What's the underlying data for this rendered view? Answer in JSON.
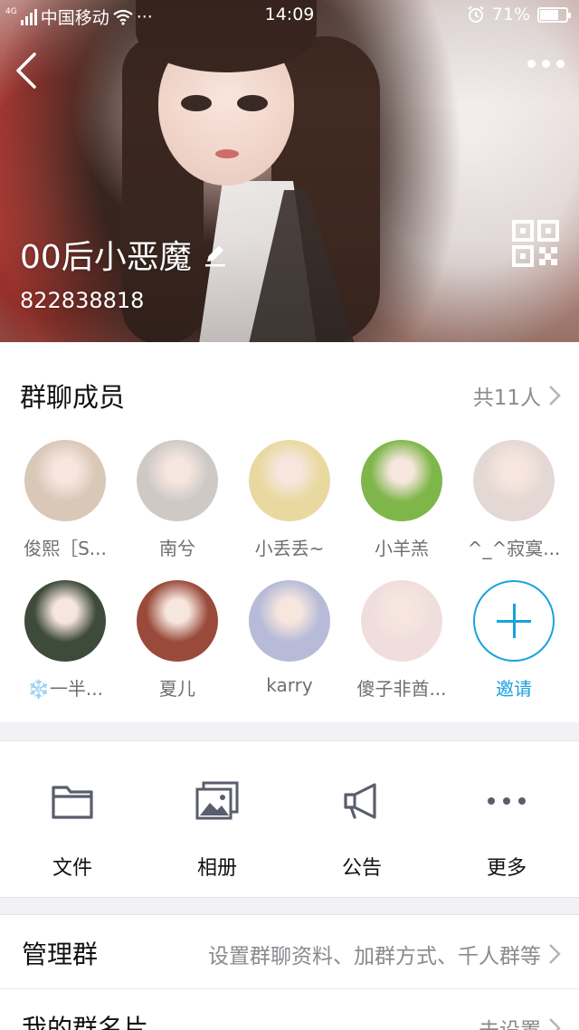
{
  "status_bar": {
    "network_type": "4G",
    "carrier": "中国移动",
    "more_dots": "···",
    "time": "14:09",
    "battery_percent": "71%",
    "battery_level": 0.71
  },
  "header": {
    "group_name": "00后小恶魔",
    "group_id": "822838818"
  },
  "members": {
    "title": "群聊成员",
    "count_label": "共11人",
    "list": [
      {
        "name": "俊熙［S...",
        "avatar_color": "#d9c7b8"
      },
      {
        "name": "南兮",
        "avatar_color": "#cfc9c6"
      },
      {
        "name": "小丢丢~",
        "avatar_color": "#e9d9a0"
      },
      {
        "name": "小羊羔",
        "avatar_color": "#7fb64a"
      },
      {
        "name": "^_^寂寞...",
        "avatar_color": "#e4d8d4"
      },
      {
        "name": "❄️一半...",
        "avatar_color": "#3e4a3a"
      },
      {
        "name": "夏儿",
        "avatar_color": "#9a4a3a"
      },
      {
        "name": "karry",
        "avatar_color": "#b7bbd8"
      },
      {
        "name": "傻子非酋...",
        "avatar_color": "#f0dede"
      }
    ],
    "invite_label": "邀请"
  },
  "tools": [
    {
      "label": "文件",
      "icon": "folder-icon"
    },
    {
      "label": "相册",
      "icon": "album-icon"
    },
    {
      "label": "公告",
      "icon": "megaphone-icon"
    },
    {
      "label": "更多",
      "icon": "more-dots-icon"
    }
  ],
  "settings": {
    "manage": {
      "label": "管理群",
      "value": "设置群聊资料、加群方式、千人群等"
    },
    "my_card": {
      "label": "我的群名片",
      "value": "未设置"
    }
  },
  "colors": {
    "accent": "#19a3dc",
    "icon_gray": "#5a5d6b",
    "secondary_text": "#8a8a8f"
  }
}
